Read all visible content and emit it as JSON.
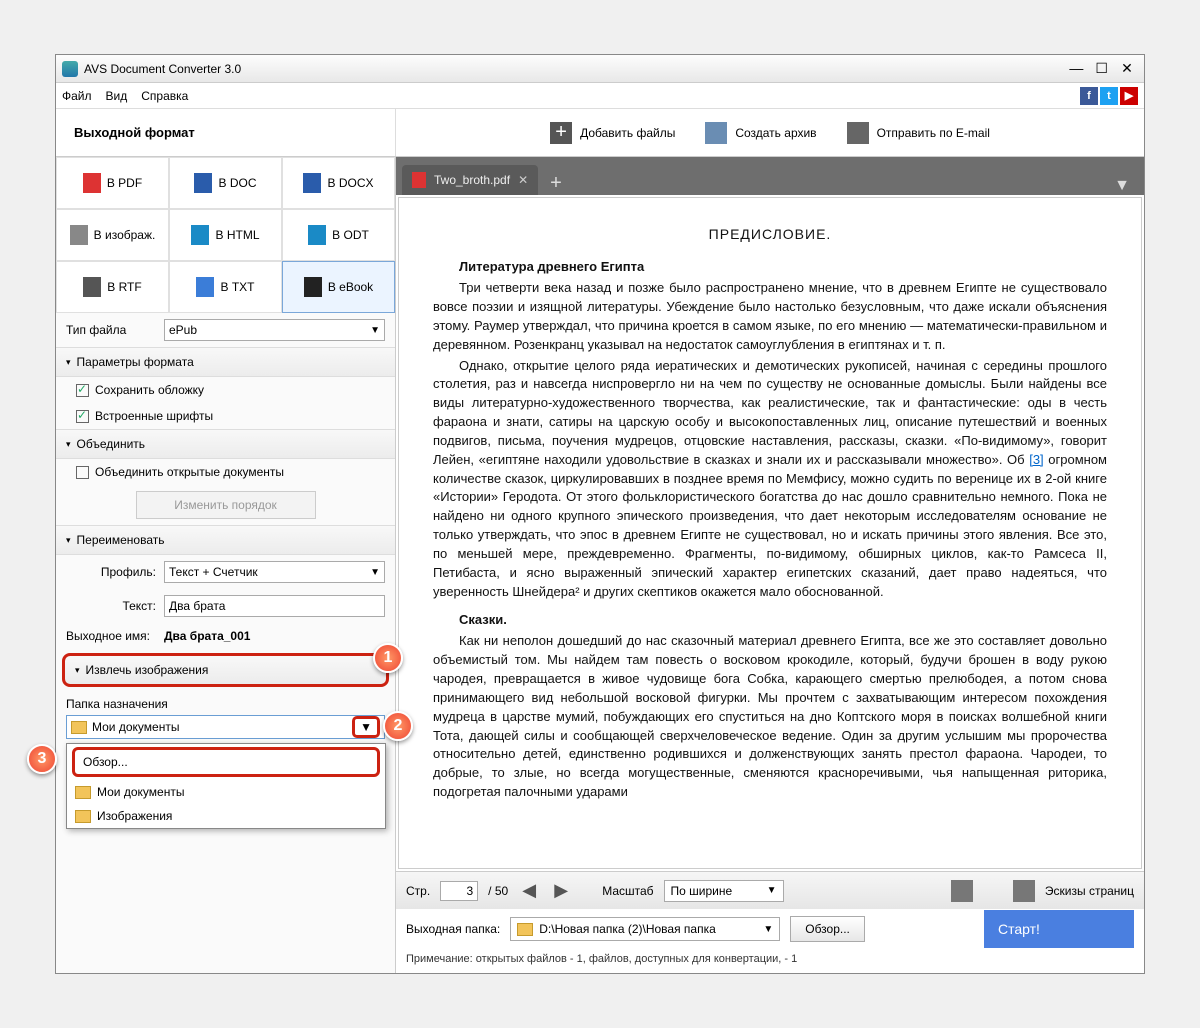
{
  "window": {
    "title": "AVS Document Converter 3.0"
  },
  "menu": {
    "file": "Файл",
    "view": "Вид",
    "help": "Справка"
  },
  "toolbar": {
    "output_format": "Выходной формат",
    "add_files": "Добавить файлы",
    "create_archive": "Создать архив",
    "send_email": "Отправить по E-mail"
  },
  "formats": {
    "pdf": "В PDF",
    "doc": "В DOC",
    "docx": "В DOCX",
    "img": "В изображ.",
    "html": "В HTML",
    "odt": "В ODT",
    "rtf": "В RTF",
    "txt": "В TXT",
    "ebook": "В eBook"
  },
  "filetype": {
    "label": "Тип файла",
    "value": "ePub"
  },
  "sections": {
    "format_params": "Параметры формата",
    "save_cover": "Сохранить обложку",
    "embed_fonts": "Встроенные шрифты",
    "merge": "Объединить",
    "merge_docs": "Объединить открытые документы",
    "change_order": "Изменить порядок",
    "rename": "Переименовать",
    "extract_images": "Извлечь изображения",
    "dest_folder": "Папка назначения"
  },
  "rename": {
    "profile_label": "Профиль:",
    "profile_value": "Текст + Счетчик",
    "text_label": "Текст:",
    "text_value": "Два брата",
    "outname_label": "Выходное имя:",
    "outname_value": "Два брата_001"
  },
  "dest": {
    "selected": "Мои документы",
    "options": {
      "browse": "Обзор...",
      "mydocs": "Мои документы",
      "images": "Изображения"
    }
  },
  "tab": {
    "name": "Two_broth.pdf"
  },
  "document": {
    "title": "ПРЕДИСЛОВИЕ.",
    "sub1": "Литература древнего Египта",
    "p1a": "Три четверти века назад и позже было распространено мнение, что в древнем Египте не существовало вовсе поэзии и изящной литературы. Убеждение было настолько безусловным, что даже искали объяснения этому. Раумер утверждал, что причина кроется в самом языке, по его мнению — математически-правильном и деревянном. Розенкранц указывал на недостаток самоуглубления в египтянах и т. п.",
    "p2": "Однако, открытие целого ряда иератических и демотических рукописей, начиная с середины прошлого столетия, раз и навсегда ниспровергло ни на чем по существу не основанные домыслы. Были найдены все виды литературно-художественного творчества, как реалистические, так и фантастические: оды в честь фараона и знати, сатиры на царскую особу и высокопоставленных лиц, описание путешествий и военных подвигов, письма, поучения мудрецов, отцовские наставления, рассказы, сказки. «По-видимому», говорит Лейен, «египтяне находили удовольствие в сказках и знали их и рассказывали множество». Об ",
    "link": "[3]",
    "p2b": " огромном количестве сказок, циркулировавших в позднее время по Мемфису, можно судить по веренице их в 2-ой книге «Истории» Геродота. От этого фольклористического богатства до нас дошло сравнительно немного. Пока не найдено ни одного крупного эпического произведения, что дает некоторым исследователям основание не только утверждать, что эпос в древнем Египте не существовал, но и искать причины этого явления. Все это, по меньшей мере, преждевременно. Фрагменты, по-видимому, обширных циклов, как-то Рамсеса II, Петибаста, и ясно выраженный эпический характер египетских сказаний, дает право надеяться, что уверенность Шнейдера² и других скептиков окажется мало обоснованной.",
    "sub2": "Сказки.",
    "p3": "Как ни неполон дошедший до нас сказочный материал древнего Египта, все же это составляет довольно объемистый том. Мы найдем там повесть о восковом крокодиле, который, будучи брошен в воду рукою чародея, превращается в живое чудовище бога Собка, карающего смертью прелюбодея, а потом снова принимающего вид небольшой восковой фигурки. Мы прочтем с захватывающим интересом похождения мудреца в царстве мумий, побуждающих его спуститься на дно Коптского моря в поисках волшебной книги Тота, дающей силы и сообщающей сверхчеловеческое ведение. Один за другим услышим мы пророчества относительно детей, единственно родившихся и долженствующих занять престол фараона. Чародеи, то добрые, то злые, но всегда могущественные, сменяются красноречивыми, чья напыщенная риторика, подогретая палочными ударами"
  },
  "nav": {
    "page_label": "Стр.",
    "page": "3",
    "total": "/ 50",
    "zoom_label": "Масштаб",
    "zoom_value": "По ширине",
    "thumbs": "Эскизы страниц"
  },
  "output": {
    "folder_label": "Выходная папка:",
    "folder_value": "D:\\Новая папка (2)\\Новая папка",
    "browse": "Обзор...",
    "start": "Старт!"
  },
  "note": "Примечание: открытых файлов - 1, файлов, доступных для конвертации, - 1"
}
